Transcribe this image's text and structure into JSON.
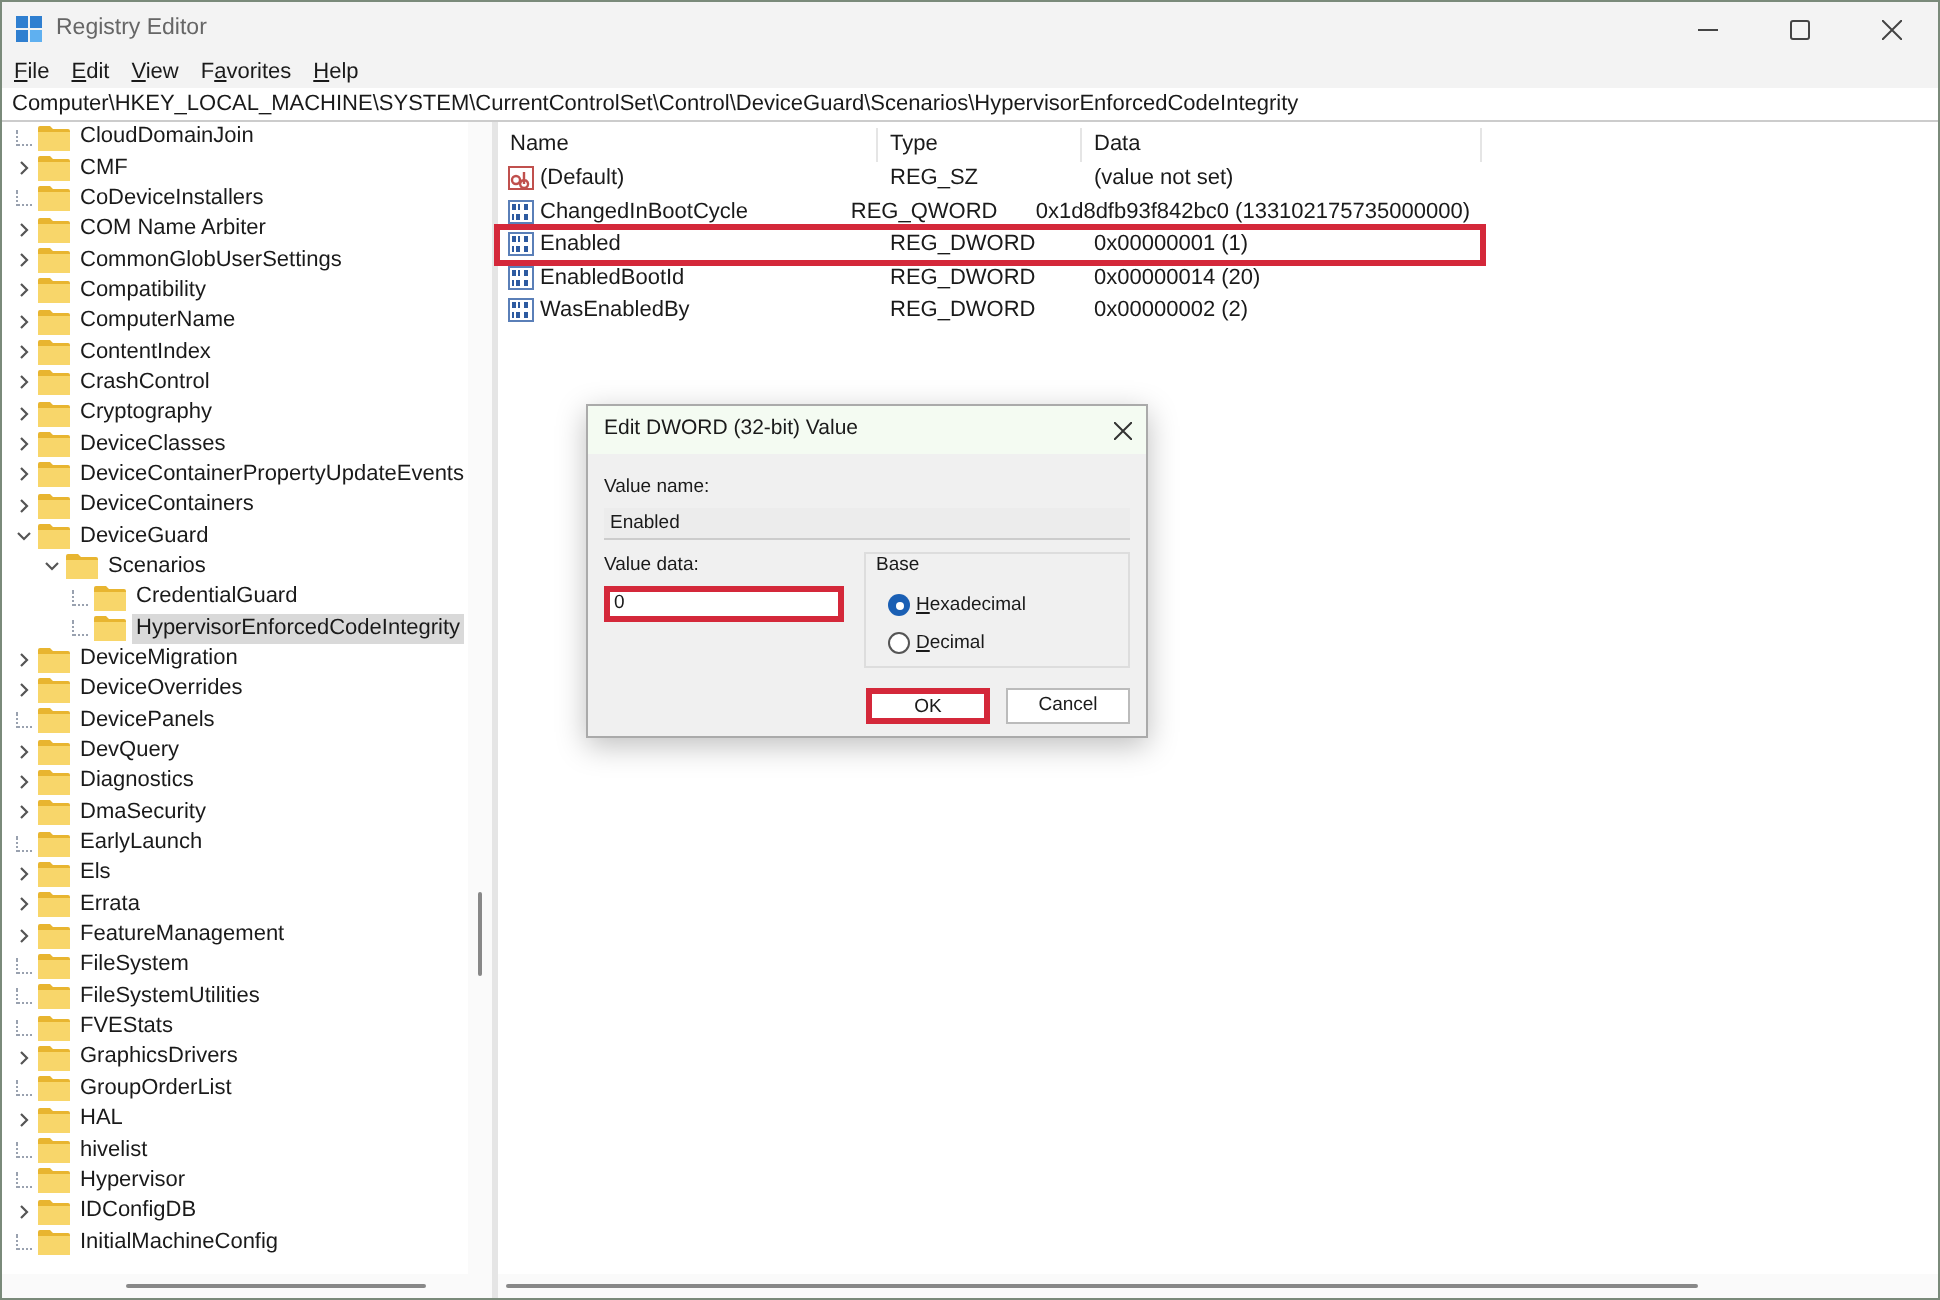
{
  "window": {
    "title": "Registry Editor"
  },
  "menu": [
    {
      "underlined": "F",
      "after": "ile"
    },
    {
      "underlined": "E",
      "after": "dit"
    },
    {
      "underlined": "V",
      "after": "iew"
    },
    {
      "before": "F",
      "underlined": "a",
      "after": "vorites"
    },
    {
      "underlined": "H",
      "after": "elp"
    }
  ],
  "address": "Computer\\HKEY_LOCAL_MACHINE\\SYSTEM\\CurrentControlSet\\Control\\DeviceGuard\\Scenarios\\HypervisorEnforcedCodeIntegrity",
  "tree": [
    {
      "label": "CloudDomainJoin",
      "expandable": false,
      "expanded": false,
      "selected": false
    },
    {
      "label": "CMF",
      "expandable": true,
      "expanded": false,
      "selected": false
    },
    {
      "label": "CoDeviceInstallers",
      "expandable": false,
      "expanded": false,
      "selected": false
    },
    {
      "label": "COM Name Arbiter",
      "expandable": true,
      "expanded": false,
      "selected": false
    },
    {
      "label": "CommonGlobUserSettings",
      "expandable": true,
      "expanded": false,
      "selected": false
    },
    {
      "label": "Compatibility",
      "expandable": true,
      "expanded": false,
      "selected": false
    },
    {
      "label": "ComputerName",
      "expandable": true,
      "expanded": false,
      "selected": false
    },
    {
      "label": "ContentIndex",
      "expandable": true,
      "expanded": false,
      "selected": false
    },
    {
      "label": "CrashControl",
      "expandable": true,
      "expanded": false,
      "selected": false
    },
    {
      "label": "Cryptography",
      "expandable": true,
      "expanded": false,
      "selected": false
    },
    {
      "label": "DeviceClasses",
      "expandable": true,
      "expanded": false,
      "selected": false
    },
    {
      "label": "DeviceContainerPropertyUpdateEvents",
      "expandable": true,
      "expanded": false,
      "selected": false
    },
    {
      "label": "DeviceContainers",
      "expandable": true,
      "expanded": false,
      "selected": false
    },
    {
      "label": "DeviceGuard",
      "expanded": true,
      "selected": false,
      "children": [
        {
          "label": "Scenarios",
          "expanded": true,
          "selected": false,
          "children": [
            {
              "label": "CredentialGuard",
              "expandable": false,
              "expanded": false,
              "selected": false
            },
            {
              "label": "HypervisorEnforcedCodeIntegrity",
              "expandable": false,
              "expanded": false,
              "selected": true
            }
          ]
        }
      ]
    },
    {
      "label": "DeviceMigration",
      "expandable": true,
      "expanded": false,
      "selected": false
    },
    {
      "label": "DeviceOverrides",
      "expandable": true,
      "expanded": false,
      "selected": false
    },
    {
      "label": "DevicePanels",
      "expandable": false,
      "expanded": false,
      "selected": false
    },
    {
      "label": "DevQuery",
      "expandable": true,
      "expanded": false,
      "selected": false
    },
    {
      "label": "Diagnostics",
      "expandable": true,
      "expanded": false,
      "selected": false
    },
    {
      "label": "DmaSecurity",
      "expandable": true,
      "expanded": false,
      "selected": false
    },
    {
      "label": "EarlyLaunch",
      "expandable": false,
      "expanded": false,
      "selected": false
    },
    {
      "label": "Els",
      "expandable": true,
      "expanded": false,
      "selected": false
    },
    {
      "label": "Errata",
      "expandable": true,
      "expanded": false,
      "selected": false
    },
    {
      "label": "FeatureManagement",
      "expandable": true,
      "expanded": false,
      "selected": false
    },
    {
      "label": "FileSystem",
      "expandable": false,
      "expanded": false,
      "selected": false
    },
    {
      "label": "FileSystemUtilities",
      "expandable": false,
      "expanded": false,
      "selected": false
    },
    {
      "label": "FVEStats",
      "expandable": false,
      "expanded": false,
      "selected": false
    },
    {
      "label": "GraphicsDrivers",
      "expandable": true,
      "expanded": false,
      "selected": false
    },
    {
      "label": "GroupOrderList",
      "expandable": false,
      "expanded": false,
      "selected": false
    },
    {
      "label": "HAL",
      "expandable": true,
      "expanded": false,
      "selected": false
    },
    {
      "label": "hivelist",
      "expandable": false,
      "expanded": false,
      "selected": false
    },
    {
      "label": "Hypervisor",
      "expandable": false,
      "expanded": false,
      "selected": false
    },
    {
      "label": "IDConfigDB",
      "expandable": true,
      "expanded": false,
      "selected": false
    },
    {
      "label": "InitialMachineConfig",
      "expandable": false,
      "expanded": false,
      "selected": false
    }
  ],
  "table": {
    "columns": [
      "Name",
      "Type",
      "Data"
    ],
    "rows": [
      {
        "kind": "string",
        "name": "(Default)",
        "type": "REG_SZ",
        "data": "(value not set)",
        "highlighted": false
      },
      {
        "kind": "binary",
        "name": "ChangedInBootCycle",
        "type": "REG_QWORD",
        "data": "0x1d8dfb93f842bc0 (133102175735000000)",
        "highlighted": false
      },
      {
        "kind": "binary",
        "name": "Enabled",
        "type": "REG_DWORD",
        "data": "0x00000001 (1)",
        "highlighted": true
      },
      {
        "kind": "binary",
        "name": "EnabledBootId",
        "type": "REG_DWORD",
        "data": "0x00000014 (20)",
        "highlighted": false
      },
      {
        "kind": "binary",
        "name": "WasEnabledBy",
        "type": "REG_DWORD",
        "data": "0x00000002 (2)",
        "highlighted": false
      }
    ]
  },
  "dialog": {
    "title": "Edit DWORD (32-bit) Value",
    "value_name_label": "Value name:",
    "value_name": "Enabled",
    "value_data_label": "Value data:",
    "value_data": "0",
    "value_data_highlighted": true,
    "base_label": "Base",
    "base_options": [
      {
        "label": "Hexadecimal",
        "selected": true
      },
      {
        "label": "Decimal",
        "selected": false
      }
    ],
    "buttons": [
      {
        "label": "OK",
        "highlighted": true
      },
      {
        "label": "Cancel",
        "highlighted": false
      }
    ]
  }
}
